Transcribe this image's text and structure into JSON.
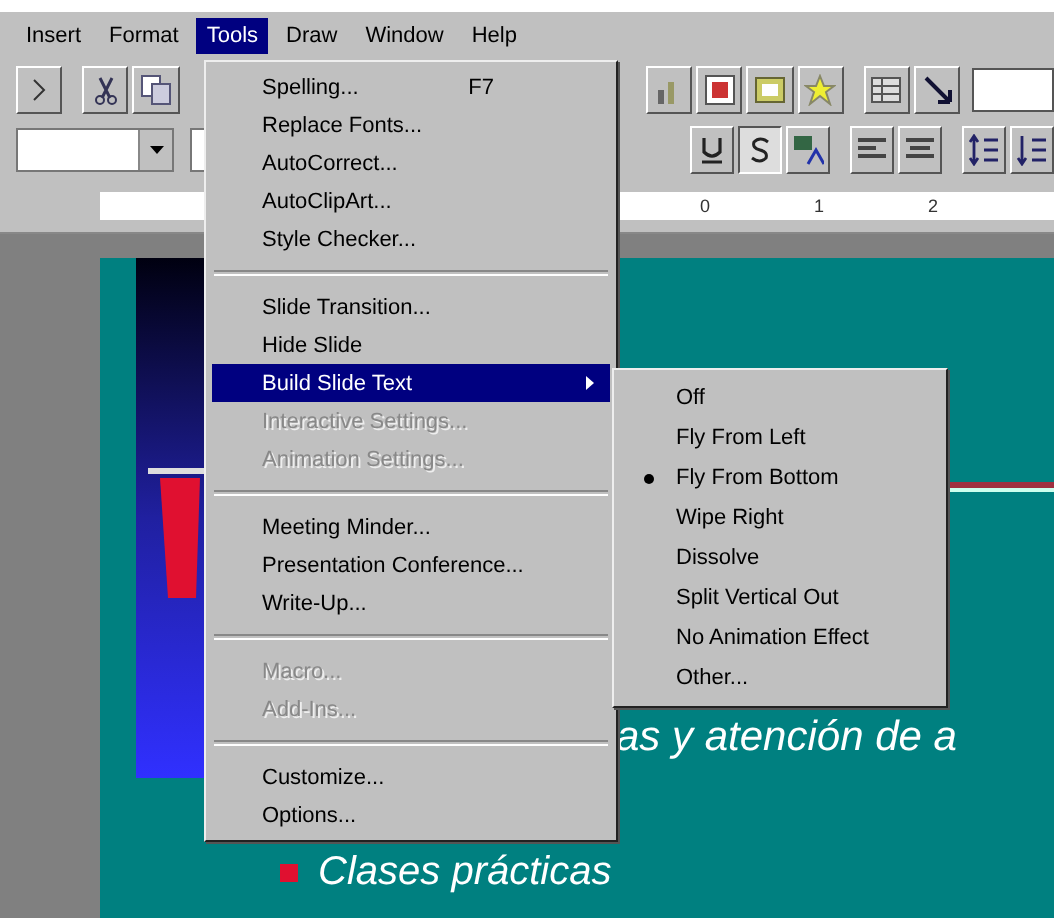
{
  "menubar": [
    {
      "label": "Insert",
      "selected": false
    },
    {
      "label": "Format",
      "selected": false
    },
    {
      "label": "Tools",
      "selected": true
    },
    {
      "label": "Draw",
      "selected": false
    },
    {
      "label": "Window",
      "selected": false
    },
    {
      "label": "Help",
      "selected": false
    }
  ],
  "ruler": {
    "labels": [
      "0",
      "1",
      "2"
    ]
  },
  "tools_menu": {
    "groups": [
      {
        "items": [
          {
            "label": "Spelling...",
            "shortcut": "F7",
            "disabled": false,
            "selected": false
          },
          {
            "label": "Replace Fonts...",
            "disabled": false,
            "selected": false
          },
          {
            "label": "AutoCorrect...",
            "disabled": false,
            "selected": false
          },
          {
            "label": "AutoClipArt...",
            "disabled": false,
            "selected": false
          },
          {
            "label": "Style Checker...",
            "disabled": false,
            "selected": false
          }
        ]
      },
      {
        "items": [
          {
            "label": "Slide Transition...",
            "disabled": false,
            "selected": false
          },
          {
            "label": "Hide Slide",
            "disabled": false,
            "selected": false
          },
          {
            "label": "Build Slide Text",
            "disabled": false,
            "selected": true,
            "has_submenu": true
          },
          {
            "label": "Interactive Settings...",
            "disabled": true,
            "selected": false
          },
          {
            "label": "Animation Settings...",
            "disabled": true,
            "selected": false
          }
        ]
      },
      {
        "items": [
          {
            "label": "Meeting Minder...",
            "disabled": false,
            "selected": false
          },
          {
            "label": "Presentation Conference...",
            "disabled": false,
            "selected": false
          },
          {
            "label": "Write-Up...",
            "disabled": false,
            "selected": false
          }
        ]
      },
      {
        "items": [
          {
            "label": "Macro...",
            "disabled": true,
            "selected": false
          },
          {
            "label": "Add-Ins...",
            "disabled": true,
            "selected": false
          }
        ]
      },
      {
        "items": [
          {
            "label": "Customize...",
            "disabled": false,
            "selected": false
          },
          {
            "label": "Options...",
            "disabled": false,
            "selected": false
          }
        ]
      }
    ]
  },
  "submenu": {
    "items": [
      {
        "label": "Off",
        "checked": false
      },
      {
        "label": "Fly From Left",
        "checked": false
      },
      {
        "label": "Fly From Bottom",
        "checked": true
      },
      {
        "label": "Wipe Right",
        "checked": false
      },
      {
        "label": "Dissolve",
        "checked": false
      },
      {
        "label": "Split Vertical Out",
        "checked": false
      },
      {
        "label": "No Animation Effect",
        "checked": false
      },
      {
        "label": "Other...",
        "checked": false
      }
    ]
  },
  "slide": {
    "line": "as y atención de a",
    "bullet": "Clases prácticas"
  }
}
